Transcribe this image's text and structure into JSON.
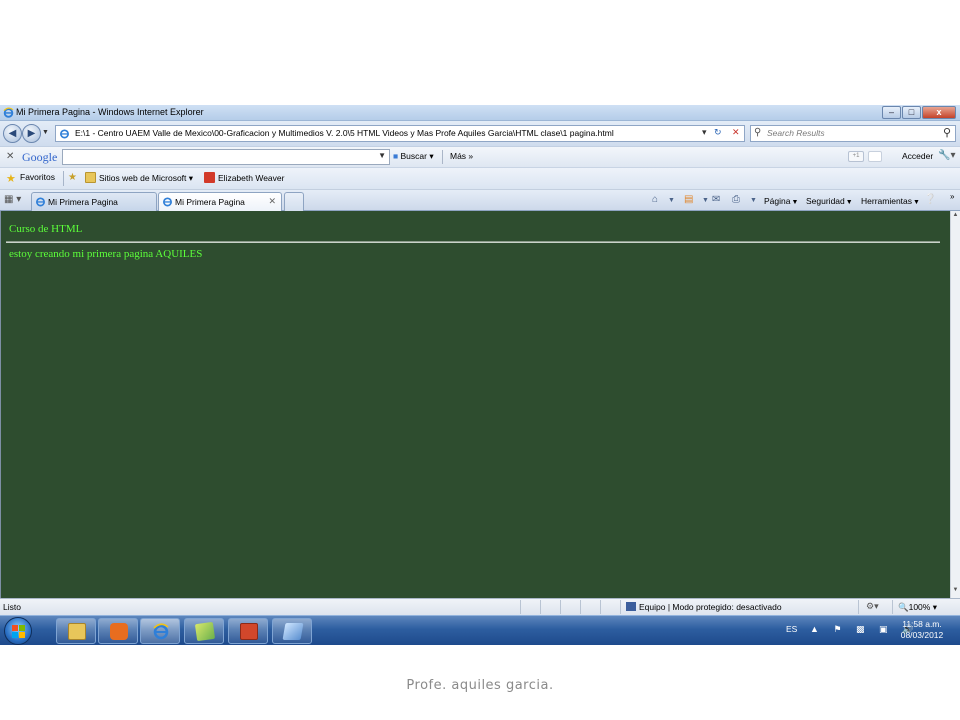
{
  "window": {
    "title": "Mi Primera Pagina - Windows Internet Explorer",
    "controls": {
      "minimize": "–",
      "maximize": "□",
      "close": "x"
    }
  },
  "address_bar": {
    "url": "E:\\1 - Centro UAEM Valle de Mexico\\00-Graficacion y Multimedios V. 2.0\\5 HTML Videos y Mas  Profe Aquiles Garcia\\HTML clase\\1 pagina.html",
    "search_placeholder": "Search Results"
  },
  "google_toolbar": {
    "logo": "Google",
    "search_button": "Buscar",
    "more": "Más",
    "plus_one": "+1",
    "sign_in": "Acceder"
  },
  "favorites_bar": {
    "favorites_label": "Favoritos",
    "items": [
      {
        "label": "Sitios web de Microsoft"
      },
      {
        "label": "Elizabeth Weaver"
      }
    ]
  },
  "tabs": [
    {
      "label": "Mi Primera Pagina",
      "active": false
    },
    {
      "label": "Mi Primera Pagina",
      "active": true
    }
  ],
  "command_bar": {
    "page": "Página",
    "safety": "Seguridad",
    "tools": "Herramientas"
  },
  "page_content": {
    "heading": "Curso de HTML",
    "paragraph": "estoy creando mi primera pagina AQUILES",
    "background_color": "#2e4d2f",
    "text_color": "#5cff3a"
  },
  "status_bar": {
    "status": "Listo",
    "zone": "Equipo | Modo protegido: desactivado",
    "zoom": "100%"
  },
  "taskbar": {
    "language": "ES",
    "time": "11:58 a.m.",
    "date": "08/03/2012"
  },
  "footer": {
    "caption": "Profe. aquiles garcia."
  }
}
